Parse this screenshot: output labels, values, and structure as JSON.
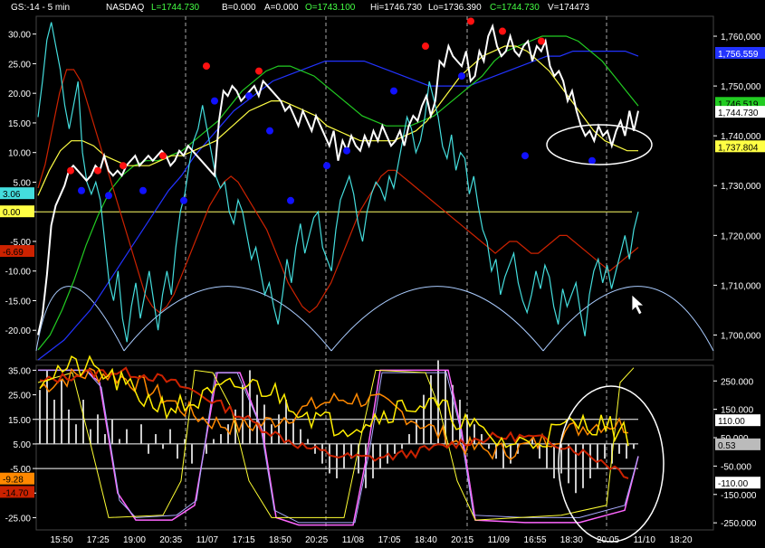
{
  "header": {
    "symbol": "GS:-14 - 5 min",
    "exchange": "NASDAQ",
    "last": "L=1744.730",
    "bid": "B=0.000",
    "ask": "A=0.000",
    "open": "O=1743.100",
    "high": "Hi=1746.730",
    "low": "Lo=1736.390",
    "close": "C=1744.730",
    "volume": "V=174473"
  },
  "colors": {
    "background": "#000000",
    "price": "#ffffff",
    "cyan": "#44dddd",
    "red": "#cc2200",
    "yellow": "#ffff44",
    "green": "#22cc22",
    "blue": "#2233ff",
    "lightblue": "#aaccff",
    "magenta": "#dd44dd",
    "orange": "#ff8800",
    "dot_red": "#ff1111",
    "dot_blue": "#1111ff"
  },
  "chart_data": [
    {
      "type": "line",
      "panel": "price",
      "x_labels": [
        "15:50",
        "17:25",
        "19:00",
        "20:35",
        "11/07",
        "17:15",
        "18:50",
        "20:25",
        "11/08",
        "17:05",
        "18:40",
        "20:15",
        "11/09",
        "16:55",
        "18:30",
        "20:05",
        "11/10",
        "18:20"
      ],
      "right_ticks": [
        "1,760,000",
        "1,750,000",
        "1,740,000",
        "1,730,000",
        "1,720,000",
        "1,710,000",
        "1,700,000"
      ],
      "left_ticks": [
        "30.00",
        "25.00",
        "20.00",
        "15.00",
        "10.00",
        "5.00",
        "0.00",
        "-5.00",
        "-10.00",
        "-15.00",
        "-20.00"
      ],
      "ylim_right": [
        1695,
        1764
      ],
      "ylim_left": [
        -25,
        33
      ],
      "right_badges": [
        {
          "text": "1,756.559",
          "value": 1756.56,
          "bg": "#2233ff",
          "fg": "#ffffff"
        },
        {
          "text": "1,746.519",
          "value": 1746.52,
          "bg": "#22cc22",
          "fg": "#000000"
        },
        {
          "text": "1,744.730",
          "value": 1744.73,
          "bg": "#ffffff",
          "fg": "#000000"
        },
        {
          "text": "1,737.804",
          "value": 1737.8,
          "bg": "#ffff44",
          "fg": "#000000"
        }
      ],
      "left_badges": [
        {
          "text": "3.06",
          "value": 3.06,
          "bg": "#44dddd",
          "fg": "#000000"
        },
        {
          "text": "0.00",
          "value": 0.0,
          "bg": "#ffff44",
          "fg": "#000000"
        },
        {
          "text": "-6.69",
          "value": -6.69,
          "bg": "#cc2200",
          "fg": "#000000"
        }
      ],
      "zero_line_value": 0.0,
      "series": [
        {
          "color": "#ffffff",
          "axis": "right",
          "values": [
            1700,
            1704,
            1712,
            1722,
            1726,
            1728,
            1730,
            1733,
            1734,
            1733,
            1732,
            1731,
            1732,
            1734,
            1733,
            1736,
            1733,
            1732,
            1733,
            1732,
            1734,
            1735,
            1736,
            1734,
            1735,
            1736,
            1735,
            1736,
            1737,
            1736,
            1734,
            1735,
            1737,
            1736,
            1738,
            1737,
            1736,
            1735,
            1734,
            1733,
            1732,
            1743,
            1749,
            1748,
            1750,
            1749,
            1747,
            1748,
            1749,
            1750,
            1748,
            1751,
            1750,
            1749,
            1748,
            1747,
            1745,
            1746,
            1744,
            1742,
            1745,
            1743,
            1741,
            1744,
            1742,
            1740,
            1738,
            1741,
            1735,
            1739,
            1737,
            1740,
            1738,
            1737,
            1740,
            1738,
            1741,
            1739,
            1742,
            1740,
            1738,
            1739,
            1741,
            1738,
            1742,
            1744,
            1743,
            1746,
            1748,
            1744,
            1747,
            1755,
            1754,
            1758,
            1756,
            1755,
            1754,
            1757,
            1751,
            1752,
            1757,
            1755,
            1760,
            1762,
            1758,
            1756,
            1757,
            1760,
            1757,
            1756,
            1758,
            1759,
            1755,
            1758,
            1757,
            1759,
            1754,
            1752,
            1753,
            1751,
            1747,
            1749,
            1745,
            1742,
            1740,
            1741,
            1739,
            1742,
            1740,
            1741,
            1738,
            1741,
            1743,
            1740,
            1745,
            1741,
            1745
          ]
        },
        {
          "color": "#44dddd",
          "axis": "left",
          "values": [
            16,
            22,
            29,
            32,
            28,
            24,
            18,
            14,
            18,
            22,
            10,
            5,
            3,
            5,
            2,
            -5,
            -12,
            -15,
            -10,
            -18,
            -22,
            -16,
            -12,
            -18,
            -14,
            -10,
            -15,
            -20,
            -14,
            -10,
            -14,
            -6,
            0,
            3,
            8,
            12,
            14,
            18,
            14,
            10,
            6,
            4,
            5,
            0,
            -2,
            2,
            0,
            -4,
            -8,
            -6,
            -10,
            -14,
            -12,
            -16,
            -19,
            -14,
            -8,
            -12,
            -6,
            -2,
            -7,
            -4,
            -1,
            0,
            -6,
            -8,
            -10,
            -3,
            2,
            4,
            6,
            3,
            -2,
            -5,
            0,
            3,
            5,
            4,
            2,
            6,
            4,
            8,
            12,
            16,
            14,
            10,
            12,
            16,
            22,
            19,
            16,
            11,
            9,
            13,
            7,
            10,
            9,
            3,
            6,
            1,
            -3,
            -5,
            -10,
            -8,
            -14,
            -11,
            -9,
            -7,
            -12,
            -15,
            -17,
            -14,
            -10,
            -13,
            -9,
            -11,
            -16,
            -19,
            -13,
            -16,
            -14,
            -12,
            -17,
            -21,
            -14,
            -10,
            -8,
            -12,
            -9,
            -13,
            -10,
            -7,
            -4,
            -8,
            -3,
            0
          ]
        },
        {
          "color": "#cc2200",
          "axis": "left",
          "values": [
            4,
            8,
            14,
            20,
            24,
            24,
            22,
            18,
            14,
            10,
            6,
            2,
            -2,
            -6,
            -10,
            -14,
            -16,
            -17,
            -16,
            -14,
            -11,
            -8,
            -5,
            -2,
            1,
            3,
            5,
            6,
            5,
            3,
            1,
            -1,
            -3,
            -6,
            -9,
            -12,
            -14,
            -16,
            -17,
            -16,
            -14,
            -12,
            -9,
            -6,
            -3,
            0,
            2,
            4,
            6,
            7,
            7,
            6,
            5,
            4,
            3,
            2,
            1,
            0,
            -1,
            -2,
            -3,
            -4,
            -5,
            -6,
            -7,
            -6,
            -5,
            -5,
            -6,
            -7,
            -7,
            -6,
            -5,
            -4,
            -4,
            -5,
            -6,
            -7,
            -8,
            -9,
            -10,
            -9,
            -8,
            -7,
            -6
          ]
        },
        {
          "color": "#ffff44",
          "axis": "right",
          "values": [
            1728,
            1733,
            1737,
            1739,
            1739,
            1738,
            1736,
            1735,
            1734,
            1734,
            1734,
            1735,
            1736,
            1736,
            1737,
            1738,
            1739,
            1741,
            1743,
            1745,
            1746,
            1747,
            1747,
            1746,
            1745,
            1744,
            1742,
            1741,
            1740,
            1739,
            1739,
            1739,
            1739,
            1740,
            1741,
            1743,
            1746,
            1749,
            1752,
            1754,
            1756,
            1757,
            1758,
            1758,
            1757,
            1755,
            1753,
            1750,
            1747,
            1744,
            1741,
            1739,
            1738,
            1737,
            1737
          ]
        },
        {
          "color": "#22cc22",
          "axis": "right",
          "values": [
            1697,
            1700,
            1705,
            1711,
            1718,
            1724,
            1729,
            1732,
            1734,
            1735,
            1735,
            1736,
            1737,
            1739,
            1741,
            1743,
            1746,
            1749,
            1751,
            1753,
            1754,
            1754,
            1753,
            1752,
            1750,
            1748,
            1746,
            1744,
            1743,
            1742,
            1742,
            1742,
            1743,
            1744,
            1746,
            1748,
            1750,
            1752,
            1755,
            1757,
            1758,
            1759,
            1760,
            1760,
            1760,
            1759,
            1757,
            1755,
            1752,
            1749,
            1746
          ]
        },
        {
          "color": "#2233ff",
          "axis": "right",
          "values": [
            1695,
            1697,
            1699,
            1702,
            1705,
            1709,
            1713,
            1717,
            1721,
            1725,
            1729,
            1732,
            1736,
            1739,
            1742,
            1745,
            1747,
            1749,
            1751,
            1752,
            1753,
            1754,
            1755,
            1755,
            1755,
            1755,
            1754,
            1753,
            1752,
            1751,
            1750,
            1750,
            1750,
            1750,
            1751,
            1752,
            1753,
            1754,
            1755,
            1756,
            1756,
            1757,
            1757,
            1757,
            1757,
            1757,
            1756
          ]
        }
      ],
      "red_dots": [
        [
          1,
          1733
        ],
        [
          2,
          1733
        ],
        [
          3,
          1734
        ],
        [
          4,
          1736
        ],
        [
          5,
          1754
        ],
        [
          6,
          1753
        ],
        [
          7,
          1758
        ],
        [
          8,
          1763
        ],
        [
          9,
          1761
        ],
        [
          10,
          1759
        ]
      ],
      "blue_dots": [
        [
          1,
          1729
        ],
        [
          2,
          1728
        ],
        [
          3,
          1729
        ],
        [
          4,
          1727
        ],
        [
          5,
          1747
        ],
        [
          6,
          1748
        ],
        [
          7,
          1741
        ],
        [
          8,
          1727
        ],
        [
          9,
          1734
        ],
        [
          10,
          1737
        ],
        [
          11,
          1749
        ],
        [
          12,
          1752
        ],
        [
          13,
          1736
        ],
        [
          14,
          1735
        ]
      ]
    },
    {
      "type": "line",
      "panel": "oscillator",
      "left_ticks": [
        "35.00",
        "25.00",
        "15.00",
        "5.00",
        "-5.00",
        "-15.00",
        "-25.00"
      ],
      "right_ticks": [
        "250.000",
        "150.000",
        "50.000",
        "-50.000",
        "-150.000",
        "-250.000"
      ],
      "ylim_left": [
        -30,
        37
      ],
      "ylim_right": [
        -275,
        305
      ],
      "hlines_left": [
        15,
        5,
        -5
      ],
      "right_badges": [
        {
          "text": "110.00",
          "value": 110,
          "bg": "#ffffff",
          "fg": "#000000"
        },
        {
          "text": "0.53",
          "value": 5,
          "bg": "#bbbbbb",
          "fg": "#000000"
        },
        {
          "text": "-110.00",
          "value": -110,
          "bg": "#ffffff",
          "fg": "#000000"
        }
      ],
      "left_badges": [
        {
          "text": "-9.28",
          "value": -9.28,
          "bg": "#ff8800",
          "fg": "#000000"
        },
        {
          "text": "-14.70",
          "value": -14.7,
          "bg": "#cc2200",
          "fg": "#000000"
        }
      ],
      "histogram_baseline": 5,
      "histogram": [
        22,
        30,
        18,
        26,
        14,
        8,
        18,
        6,
        12,
        4,
        10,
        2,
        6,
        0,
        8,
        -4,
        4,
        -2,
        6,
        -6,
        2,
        -8,
        0,
        -4,
        2,
        4,
        8,
        14,
        24,
        30,
        20,
        16,
        8,
        12,
        18,
        10,
        6,
        2,
        -4,
        -8,
        -12,
        -14,
        -10,
        -6,
        -12,
        -18,
        -14,
        -10,
        -8,
        -4,
        -2,
        4,
        10,
        20,
        28,
        34,
        30,
        24,
        18,
        12,
        8,
        4,
        -2,
        -6,
        -10,
        -8,
        -4,
        0,
        2,
        -6,
        -10,
        -14,
        -12,
        -16,
        -20,
        -18,
        -14,
        -10,
        -6,
        -8,
        -4,
        -6,
        -2
      ]
    }
  ]
}
